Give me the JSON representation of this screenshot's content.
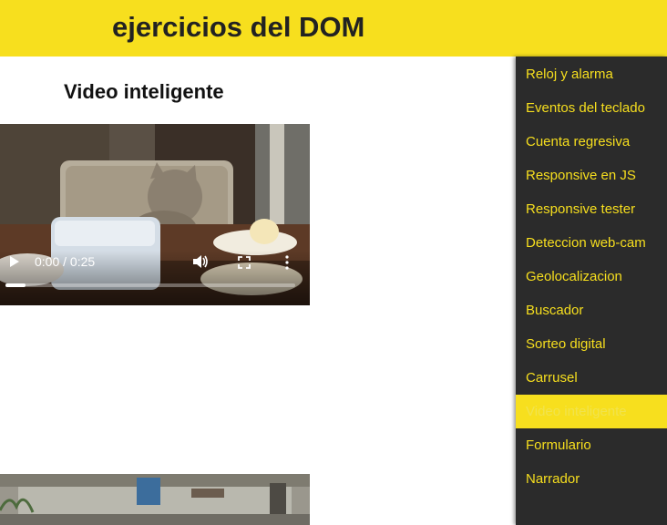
{
  "header": {
    "title": "ejercicios del DOM"
  },
  "section": {
    "title": "Video inteligente"
  },
  "video": {
    "time": "0:00 / 0:25",
    "progress": 0.07
  },
  "menu": {
    "items": [
      {
        "label": "Reloj y alarma"
      },
      {
        "label": "Eventos del teclado"
      },
      {
        "label": "Cuenta regresiva"
      },
      {
        "label": "Responsive en JS"
      },
      {
        "label": "Responsive tester"
      },
      {
        "label": "Deteccion web-cam"
      },
      {
        "label": "Geolocalizacion"
      },
      {
        "label": "Buscador"
      },
      {
        "label": "Sorteo digital"
      },
      {
        "label": "Carrusel"
      },
      {
        "label": "Video inteligente",
        "active": true
      },
      {
        "label": "Formulario"
      },
      {
        "label": "Narrador"
      }
    ]
  },
  "colors": {
    "accent": "#f7df1e",
    "menu_bg": "#2b2b2b"
  }
}
